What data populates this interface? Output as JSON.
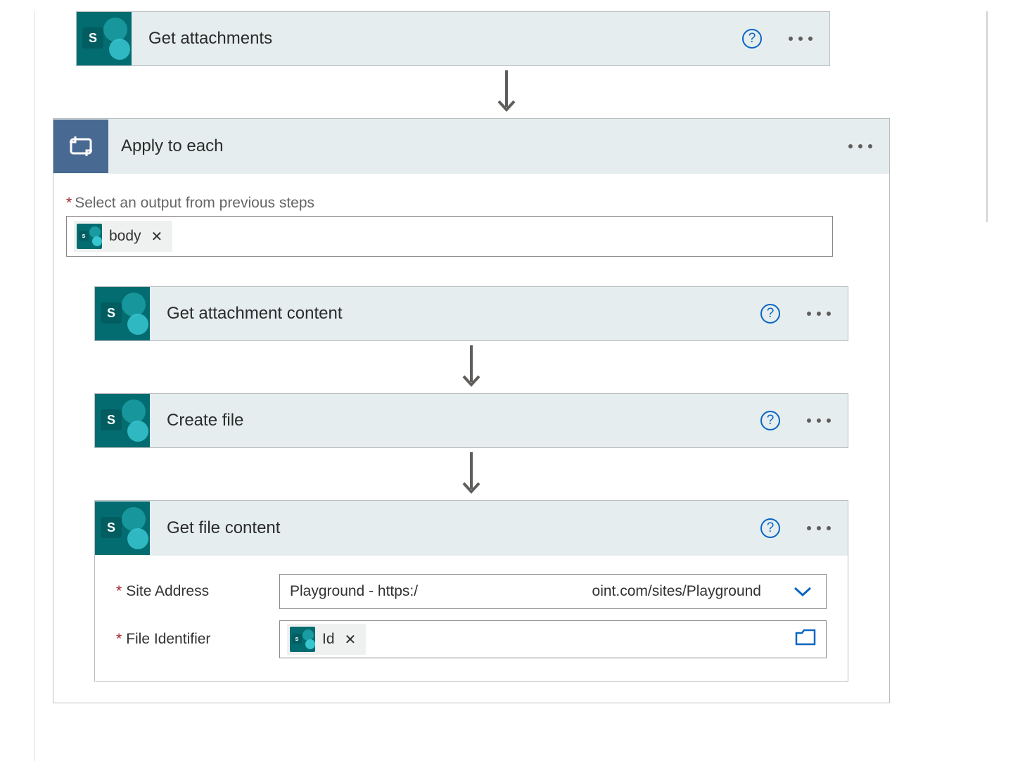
{
  "steps": {
    "getAttachments": {
      "title": "Get attachments"
    },
    "applyToEach": {
      "title": "Apply to each",
      "outputLabel": "Select an output from previous steps",
      "outputToken": "body"
    },
    "getAttachmentContent": {
      "title": "Get attachment content"
    },
    "createFile": {
      "title": "Create file"
    },
    "getFileContent": {
      "title": "Get file content",
      "siteAddressLabel": "Site Address",
      "siteAddressValuePre": "Playground - https:/",
      "siteAddressValuePost": "oint.com/sites/Playground",
      "fileIdLabel": "File Identifier",
      "fileIdToken": "Id"
    }
  },
  "icons": {
    "spLetter": "S",
    "spLetterSmall": "s"
  }
}
